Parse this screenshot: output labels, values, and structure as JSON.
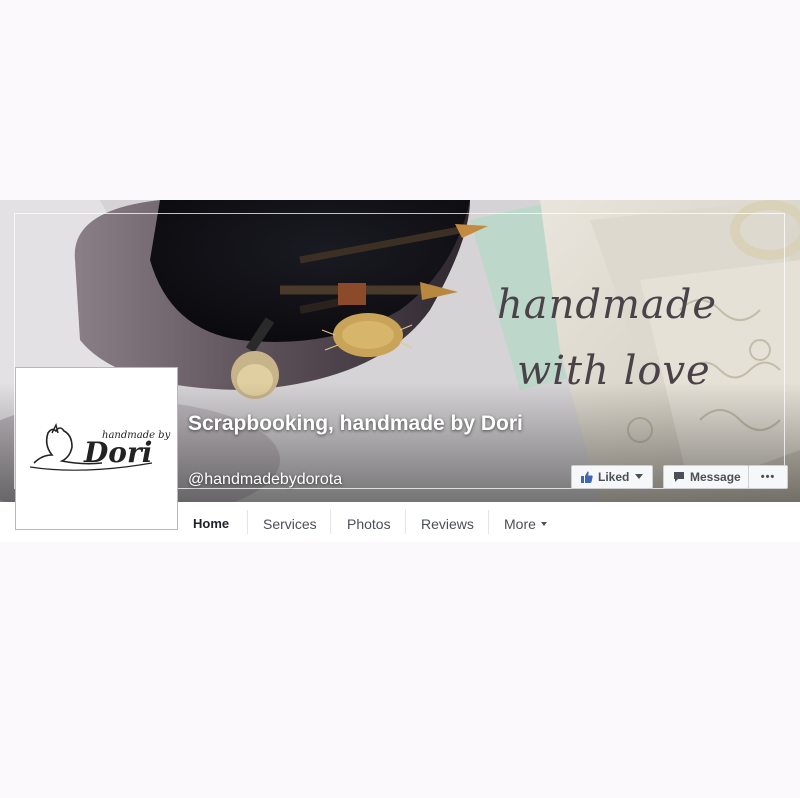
{
  "cover": {
    "tagline_line1": "handmade",
    "tagline_line2": "with love"
  },
  "page": {
    "title": "Scrapbooking, handmade by Dori",
    "handle": "@handmadebydorota"
  },
  "profile_logo": {
    "small_text": "handmade by",
    "big_text": "Dori"
  },
  "actions": {
    "liked_label": "Liked",
    "message_label": "Message",
    "more_label": "•••"
  },
  "tabs": [
    {
      "label": "Home",
      "active": true
    },
    {
      "label": "Services"
    },
    {
      "label": "Photos"
    },
    {
      "label": "Reviews"
    },
    {
      "label": "More"
    }
  ],
  "colors": {
    "accent": "#4267b2",
    "button_bg": "#f6f7f9",
    "page_bg": "#fbf9fb"
  },
  "icons": {
    "liked": "thumbs-up-icon",
    "message": "speech-bubble-icon",
    "caret": "caret-down-icon"
  }
}
